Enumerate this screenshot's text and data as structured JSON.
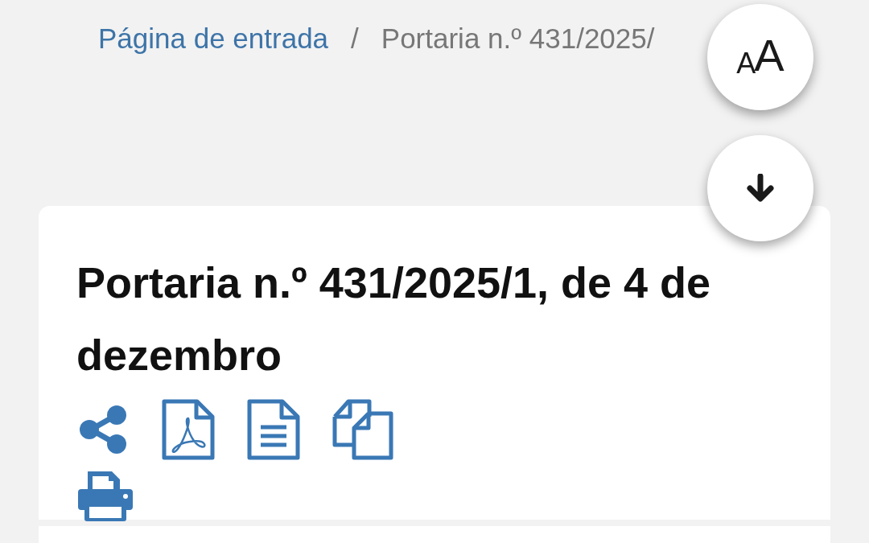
{
  "breadcrumb": [
    {
      "label": "Página de entrada",
      "kind": "link"
    },
    {
      "label": "Portaria n.º 431/2025/",
      "kind": "current"
    }
  ],
  "breadcrumb_separator": "/",
  "font_size_button": {
    "small": "A",
    "large": "A"
  },
  "document": {
    "title": "Portaria n.º 431/2025/1, de 4 de dezembro",
    "actions": [
      {
        "kind": "share"
      },
      {
        "kind": "pdf"
      },
      {
        "kind": "text"
      },
      {
        "kind": "copy"
      },
      {
        "kind": "print"
      }
    ]
  }
}
